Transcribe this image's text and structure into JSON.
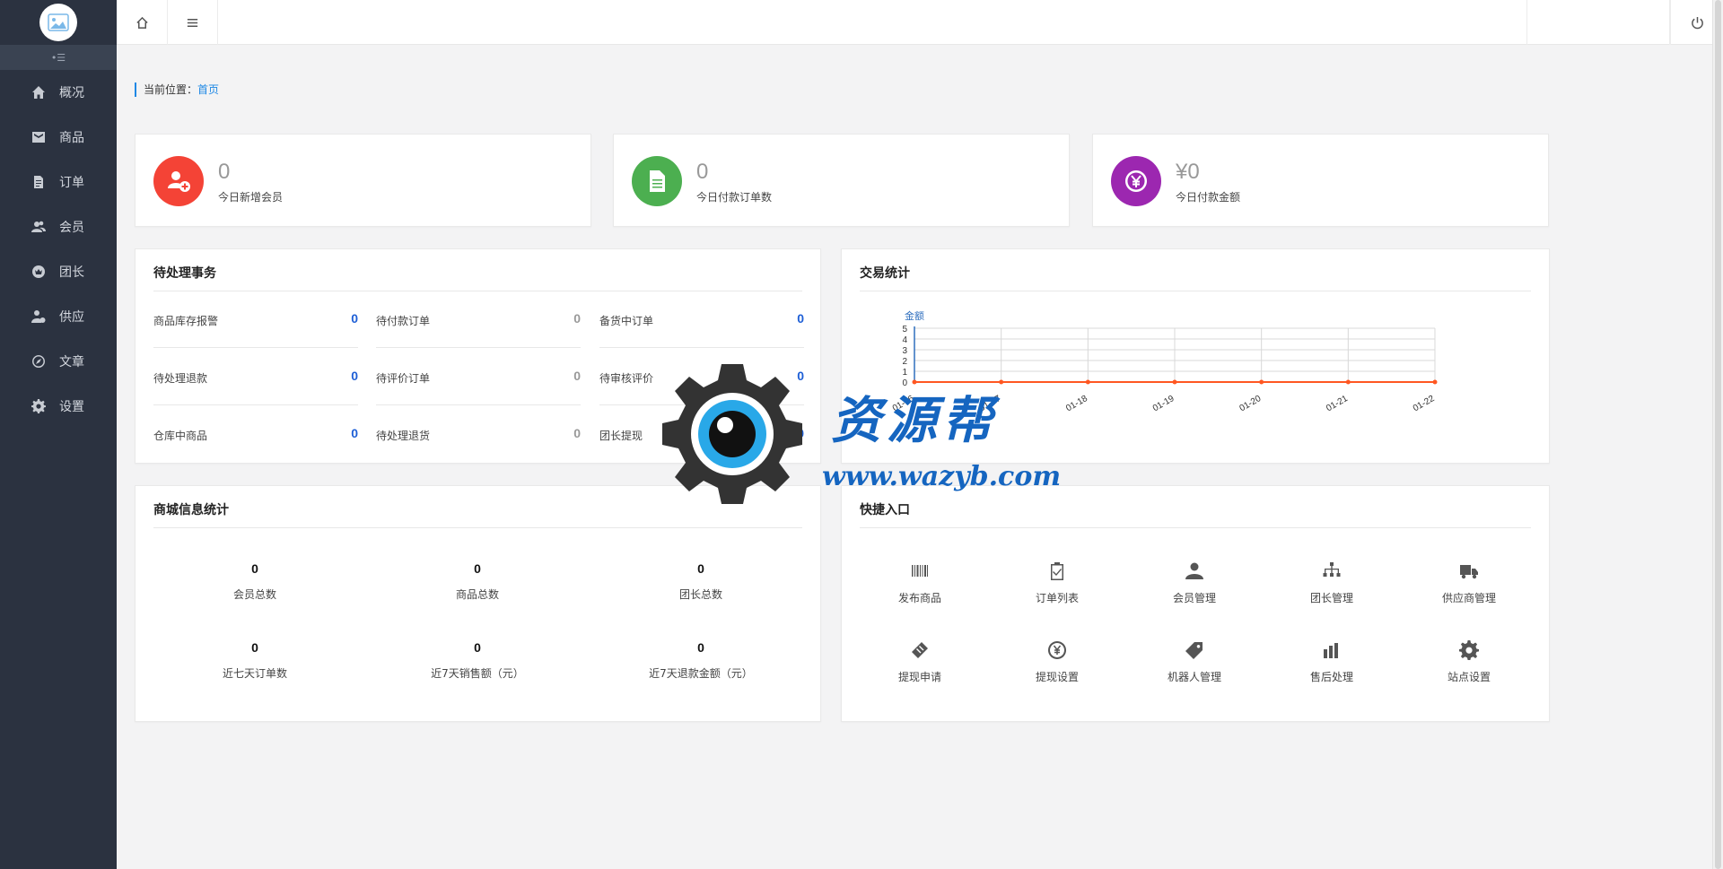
{
  "sidebar": {
    "collapse_label": "•☰",
    "items": [
      {
        "label": "概况",
        "icon": "home-icon"
      },
      {
        "label": "商品",
        "icon": "goods-icon"
      },
      {
        "label": "订单",
        "icon": "order-icon"
      },
      {
        "label": "会员",
        "icon": "members-icon"
      },
      {
        "label": "团长",
        "icon": "crown-icon"
      },
      {
        "label": "供应",
        "icon": "supplier-icon"
      },
      {
        "label": "文章",
        "icon": "compass-icon"
      },
      {
        "label": "设置",
        "icon": "gear-icon"
      }
    ]
  },
  "breadcrumb": {
    "prefix": "当前位置：",
    "current": "首页"
  },
  "stats": [
    {
      "value": "0",
      "label": "今日新增会员",
      "color": "#f44336",
      "icon": "add-user-icon"
    },
    {
      "value": "0",
      "label": "今日付款订单数",
      "color": "#4caf50",
      "icon": "document-icon"
    },
    {
      "value": "¥0",
      "label": "今日付款金额",
      "color": "#9c27b0",
      "icon": "yen-icon"
    }
  ],
  "pending": {
    "title": "待处理事务",
    "rows": [
      [
        {
          "label": "商品库存报警",
          "value": "0",
          "tone": "blue"
        },
        {
          "label": "待付款订单",
          "value": "0",
          "tone": "gray"
        },
        {
          "label": "备货中订单",
          "value": "0",
          "tone": "blue"
        }
      ],
      [
        {
          "label": "待处理退款",
          "value": "0",
          "tone": "blue"
        },
        {
          "label": "待评价订单",
          "value": "0",
          "tone": "gray"
        },
        {
          "label": "待审核评价",
          "value": "0",
          "tone": "blue"
        }
      ],
      [
        {
          "label": "仓库中商品",
          "value": "0",
          "tone": "blue"
        },
        {
          "label": "待处理退货",
          "value": "0",
          "tone": "gray"
        },
        {
          "label": "团长提现",
          "value": "0",
          "tone": "blue"
        }
      ]
    ]
  },
  "trade": {
    "title": "交易统计"
  },
  "chart_data": {
    "type": "line",
    "ylabel": "金额",
    "categories": [
      "01-16",
      "01-17",
      "01-18",
      "01-19",
      "01-20",
      "01-21",
      "01-22"
    ],
    "series": [
      {
        "values": [
          0,
          0,
          0,
          0,
          0,
          0,
          0
        ],
        "color": "#ff5722"
      }
    ],
    "ylim": [
      0,
      5
    ],
    "yticks": [
      "0",
      "1",
      "2",
      "3",
      "4",
      "5"
    ],
    "grid": true
  },
  "mall": {
    "title": "商城信息统计",
    "items": [
      {
        "value": "0",
        "label": "会员总数"
      },
      {
        "value": "0",
        "label": "商品总数"
      },
      {
        "value": "0",
        "label": "团长总数"
      },
      {
        "value": "0",
        "label": "近七天订单数"
      },
      {
        "value": "0",
        "label": "近7天销售额（元）"
      },
      {
        "value": "0",
        "label": "近7天退款金额（元）"
      }
    ]
  },
  "quick": {
    "title": "快捷入口",
    "items": [
      {
        "label": "发布商品",
        "icon": "barcode-icon"
      },
      {
        "label": "订单列表",
        "icon": "clipboard-check-icon"
      },
      {
        "label": "会员管理",
        "icon": "user-manage-icon"
      },
      {
        "label": "团长管理",
        "icon": "org-chart-icon"
      },
      {
        "label": "供应商管理",
        "icon": "truck-icon"
      },
      {
        "label": "提现申请",
        "icon": "ticket-icon"
      },
      {
        "label": "提现设置",
        "icon": "yen-circle-icon"
      },
      {
        "label": "机器人管理",
        "icon": "tag-icon"
      },
      {
        "label": "售后处理",
        "icon": "bar-chart-icon"
      },
      {
        "label": "站点设置",
        "icon": "gear-icon"
      }
    ]
  },
  "watermark": {
    "text": "资源帮",
    "url": "www.wazyb.com"
  }
}
